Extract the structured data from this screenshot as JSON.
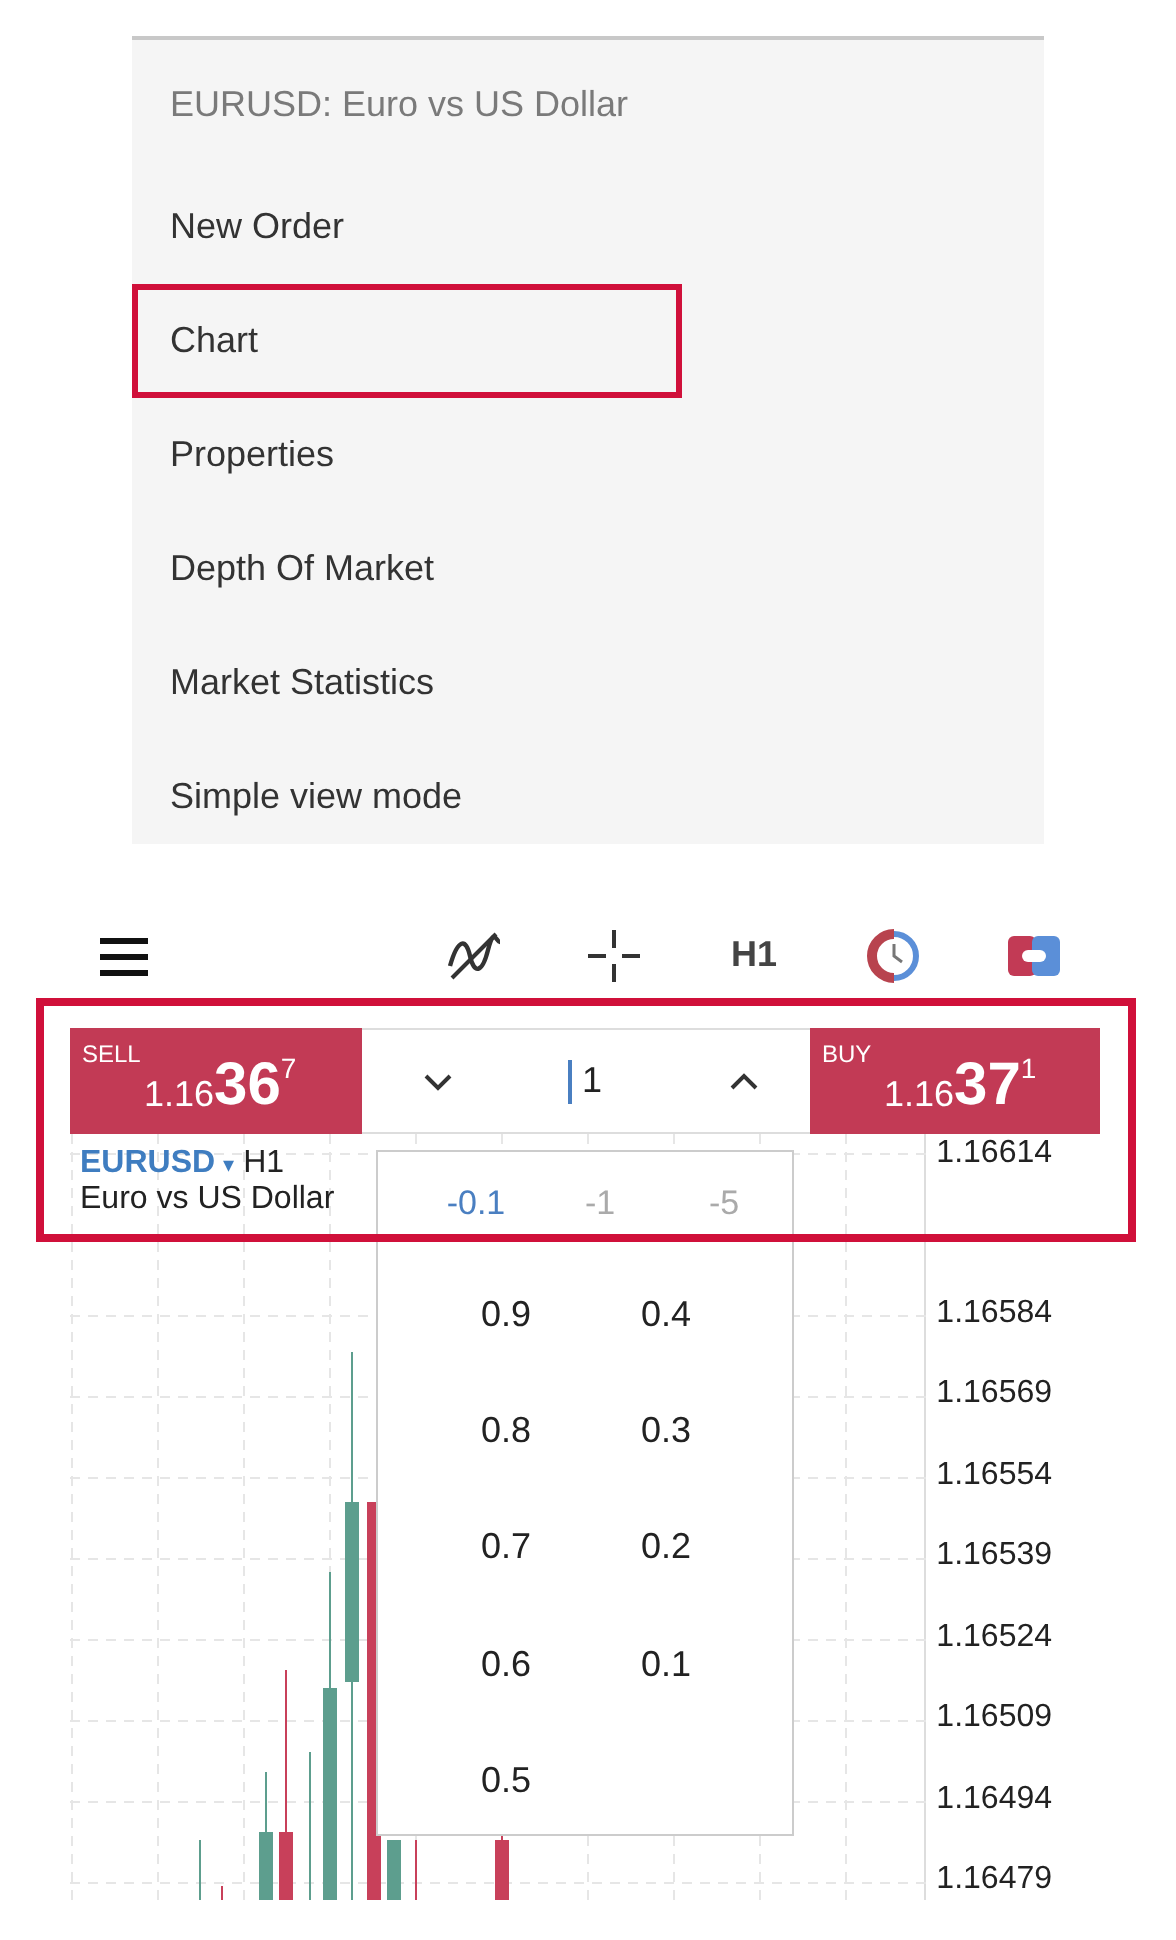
{
  "context_menu": {
    "title": "EURUSD: Euro vs US Dollar",
    "items": [
      {
        "label": "New Order",
        "highlighted": false
      },
      {
        "label": "Chart",
        "highlighted": true
      },
      {
        "label": "Properties",
        "highlighted": false
      },
      {
        "label": "Depth Of Market",
        "highlighted": false
      },
      {
        "label": "Market Statistics",
        "highlighted": false
      },
      {
        "label": "Simple view mode",
        "highlighted": false
      }
    ]
  },
  "toolbar": {
    "timeframe": "H1"
  },
  "trade_panel": {
    "highlighted": true,
    "sell": {
      "label": "SELL",
      "price_prefix": "1.16",
      "price_main": "36",
      "price_sup": "7"
    },
    "volume": {
      "value": "1"
    },
    "buy": {
      "label": "BUY",
      "price_prefix": "1.16",
      "price_main": "37",
      "price_sup": "1"
    }
  },
  "chart": {
    "symbol": "EURUSD",
    "symbol_caret": "▾",
    "timeframe": "H1",
    "description": "Euro vs US Dollar",
    "price_axis": [
      "1.16614",
      "1.16584",
      "1.16569",
      "1.16554",
      "1.16539",
      "1.16524",
      "1.16509",
      "1.16494",
      "1.16479"
    ]
  },
  "volume_popup": {
    "steps": [
      {
        "label": "-0.1",
        "disabled": false
      },
      {
        "label": "-1",
        "disabled": true
      },
      {
        "label": "-5",
        "disabled": true
      }
    ],
    "options": [
      "0.9",
      "0.4",
      "0.8",
      "0.3",
      "0.7",
      "0.2",
      "0.6",
      "0.1",
      "0.5"
    ]
  }
}
